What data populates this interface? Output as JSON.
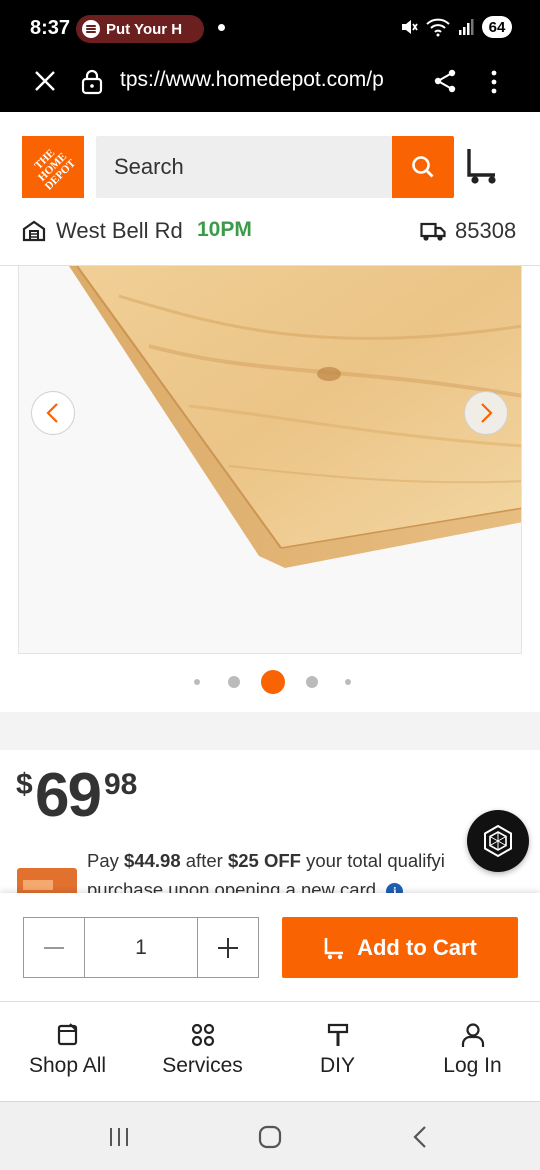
{
  "status_bar": {
    "time": "8:37",
    "media_label": "Put Your H",
    "battery": "64"
  },
  "browser": {
    "url": "tps://www.homedepot.com/p"
  },
  "header": {
    "logo_text": "THE\nHOME\nDEPOT",
    "search_placeholder": "Search",
    "store_name": "West Bell Rd",
    "store_hours": "10PM",
    "zip_code": "85308"
  },
  "gallery": {
    "slide_count": 5,
    "active_slide": 3
  },
  "price": {
    "dollar_sign": "$",
    "dollars": "69",
    "cents": "98",
    "promo_prefix": "Pay ",
    "promo_amount": "$44.98",
    "promo_middle": " after ",
    "promo_discount": "$25 OFF",
    "promo_line1_suffix": " your total qualifyi",
    "promo_line2": "purchase upon opening a new card.",
    "info_glyph": "i"
  },
  "cart_bar": {
    "quantity": "1",
    "add_to_cart_label": "Add to Cart"
  },
  "bottom_nav": {
    "items": [
      {
        "label": "Shop All",
        "icon": "shop-all-icon"
      },
      {
        "label": "Services",
        "icon": "services-icon"
      },
      {
        "label": "DIY",
        "icon": "hammer-icon"
      },
      {
        "label": "Log In",
        "icon": "person-icon"
      }
    ]
  },
  "colors": {
    "brand_orange": "#f96302",
    "store_hours_green": "#3d9a4a",
    "text_dark": "#333333"
  }
}
